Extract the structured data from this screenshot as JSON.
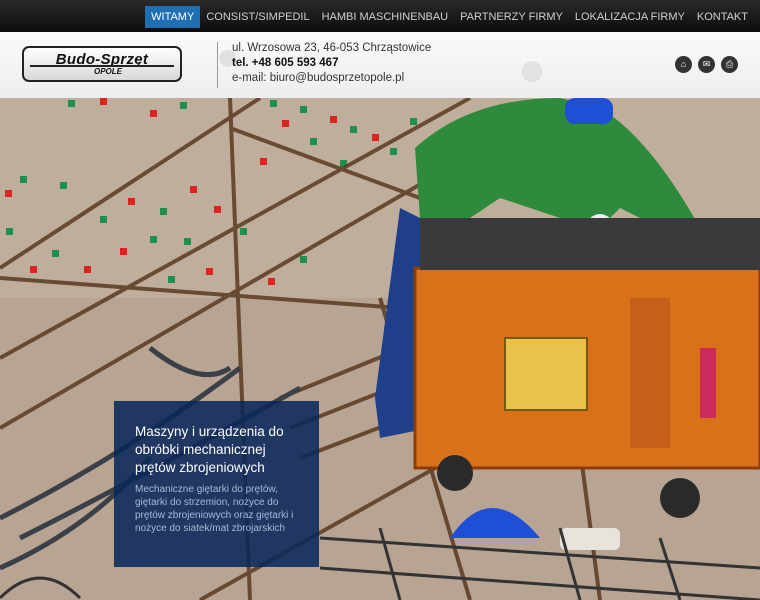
{
  "nav": {
    "items": [
      {
        "label": "WITAMY",
        "active": true
      },
      {
        "label": "CONSIST/SIMPEDIL",
        "active": false
      },
      {
        "label": "HAMBI MASCHINENBAU",
        "active": false
      },
      {
        "label": "PARTNERZY FIRMY",
        "active": false
      },
      {
        "label": "LOKALIZACJA FIRMY",
        "active": false
      },
      {
        "label": "KONTAKT",
        "active": false
      }
    ],
    "active_color": "#1f6fb3"
  },
  "logo": {
    "main": "Budo-Sprzęt",
    "sub": "OPOLE"
  },
  "contact": {
    "address": "ul. Wrzosowa 23, 46-053 Chrząstowice",
    "phone": "tel. +48 605 593 467",
    "email": "e-mail: biuro@budosprzetopole.pl"
  },
  "icons": [
    "home-icon",
    "mail-icon",
    "print-icon"
  ],
  "caption": {
    "title": "Maszyny i urządzenia do obróbki mechanicznej prętów zbrojeniowych",
    "text": "Mechaniczne giętarki do prętów, giętarki do strzemion, nożyce do prętów zbrojeniowych oraz giętarki i nożyce do siatek/mat zbrojarskich"
  }
}
